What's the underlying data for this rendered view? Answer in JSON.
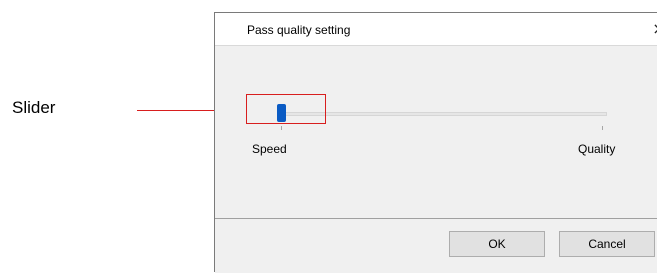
{
  "annotation": {
    "label": "Slider",
    "line_color": "#d81e1e"
  },
  "dialog": {
    "title": "Pass quality setting",
    "close_icon": "close-icon",
    "slider": {
      "min_label": "Speed",
      "max_label": "Quality",
      "value_fraction": 0.0,
      "thumb_color": "#0a5bc4"
    },
    "buttons": {
      "ok_label": "OK",
      "cancel_label": "Cancel"
    }
  }
}
